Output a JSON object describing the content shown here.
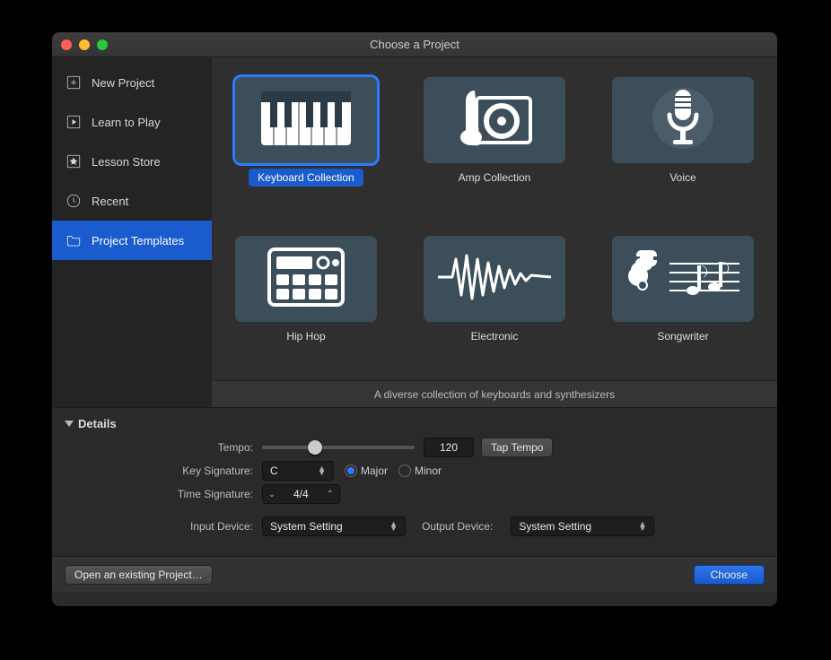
{
  "window": {
    "title": "Choose a Project"
  },
  "sidebar": {
    "items": [
      {
        "label": "New Project"
      },
      {
        "label": "Learn to Play"
      },
      {
        "label": "Lesson Store"
      },
      {
        "label": "Recent"
      },
      {
        "label": "Project Templates"
      }
    ],
    "selected_index": 4
  },
  "templates": {
    "items": [
      {
        "label": "Keyboard Collection",
        "icon": "keyboard"
      },
      {
        "label": "Amp Collection",
        "icon": "amp"
      },
      {
        "label": "Voice",
        "icon": "mic"
      },
      {
        "label": "Hip Hop",
        "icon": "drum-machine"
      },
      {
        "label": "Electronic",
        "icon": "waveform"
      },
      {
        "label": "Songwriter",
        "icon": "guitar-notes"
      }
    ],
    "selected_index": 0,
    "description": "A diverse collection of keyboards and synthesizers"
  },
  "details": {
    "header": "Details",
    "tempo_label": "Tempo:",
    "tempo_value": "120",
    "tap_tempo_label": "Tap Tempo",
    "key_signature_label": "Key Signature:",
    "key_value": "C",
    "mode_major_label": "Major",
    "mode_minor_label": "Minor",
    "mode_value": "Major",
    "time_signature_label": "Time Signature:",
    "time_signature_value": "4/4",
    "input_device_label": "Input Device:",
    "input_device_value": "System Setting",
    "output_device_label": "Output Device:",
    "output_device_value": "System Setting"
  },
  "footer": {
    "open_existing_label": "Open an existing Project…",
    "choose_label": "Choose"
  }
}
